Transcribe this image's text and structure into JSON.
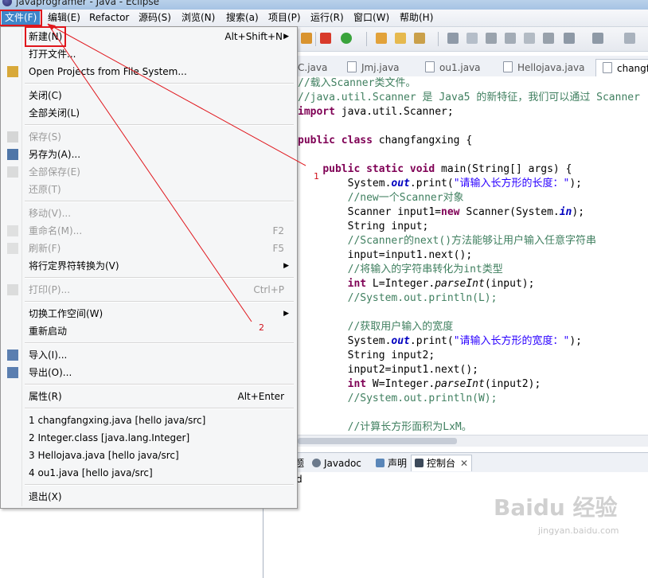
{
  "window": {
    "title": "javaprogramer - Java - Eclipse"
  },
  "menubar": {
    "items": [
      "文件(F)",
      "编辑(E)",
      "Refactor",
      "源码(S)",
      "浏览(N)",
      "搜索(a)",
      "项目(P)",
      "运行(R)",
      "窗口(W)",
      "帮助(H)"
    ]
  },
  "file_menu": {
    "items": [
      {
        "label": "新建(N)",
        "accel": "Alt+Shift+N",
        "submenu": true,
        "enabled": true
      },
      {
        "label": "打开文件...",
        "accel": "",
        "enabled": true
      },
      {
        "label": "Open Projects from File System...",
        "accel": "",
        "enabled": true
      },
      {
        "label": "关闭(C)",
        "accel": "",
        "enabled": true
      },
      {
        "label": "全部关闭(L)",
        "accel": "",
        "enabled": true
      },
      {
        "label": "保存(S)",
        "accel": "",
        "enabled": false
      },
      {
        "label": "另存为(A)...",
        "accel": "",
        "enabled": true
      },
      {
        "label": "全部保存(E)",
        "accel": "",
        "enabled": false
      },
      {
        "label": "还原(T)",
        "accel": "",
        "enabled": false
      },
      {
        "label": "移动(V)...",
        "accel": "",
        "enabled": false
      },
      {
        "label": "重命名(M)...",
        "accel": "F2",
        "enabled": false
      },
      {
        "label": "刷新(F)",
        "accel": "F5",
        "enabled": false
      },
      {
        "label": "将行定界符转换为(V)",
        "accel": "",
        "submenu": true,
        "enabled": true
      },
      {
        "label": "打印(P)...",
        "accel": "Ctrl+P",
        "enabled": false
      },
      {
        "label": "切换工作空间(W)",
        "accel": "",
        "submenu": true,
        "enabled": true
      },
      {
        "label": "重新启动",
        "accel": "",
        "enabled": true
      },
      {
        "label": "导入(I)...",
        "accel": "",
        "enabled": true
      },
      {
        "label": "导出(O)...",
        "accel": "",
        "enabled": true
      },
      {
        "label": "属性(R)",
        "accel": "Alt+Enter",
        "enabled": true
      },
      {
        "label": "1 changfangxing.java  [hello java/src]",
        "accel": "",
        "enabled": true
      },
      {
        "label": "2 Integer.class  [java.lang.Integer]",
        "accel": "",
        "enabled": true
      },
      {
        "label": "3 Hellojava.java  [hello java/src]",
        "accel": "",
        "enabled": true
      },
      {
        "label": "4 ou1.java  [hello java/src]",
        "accel": "",
        "enabled": true
      },
      {
        "label": "退出(X)",
        "accel": "",
        "enabled": true
      }
    ]
  },
  "editor_tabs": [
    "C.java",
    "Jmj.java",
    "ou1.java",
    "Hellojava.java",
    "changf"
  ],
  "code_lines": [
    "//载入Scanner类文件。",
    "//java.util.Scanner 是 Java5 的新特征，我们可以通过 Scanner",
    "import java.util.Scanner;",
    "",
    "public class changfangxing {",
    "",
    "    public static void main(String[] args) {",
    "        System.out.print(\"请输入长方形的长度：\");",
    "        //new一个Scanner对象",
    "        Scanner input1=new Scanner(System.in);",
    "        String input;",
    "        //Scanner的next()方法能够让用户输入任意字符串",
    "        input=input1.next();",
    "        //将输入的字符串转化为int类型",
    "        int L=Integer.parseInt(input);",
    "        //System.out.println(L);",
    "",
    "        //获取用户输入的宽度",
    "        System.out.print(\"请输入长方形的宽度：\");",
    "        String input2;",
    "        input2=input1.next();",
    "        int W=Integer.parseInt(input2);",
    "        //System.out.println(W);",
    "",
    "        //计算长方形面积为LxM。"
  ],
  "bottom_tabs": [
    "题",
    "Javadoc",
    "声明",
    "控制台"
  ],
  "console_text": "d",
  "annotations": {
    "step1": "1",
    "step2": "2"
  },
  "watermark": {
    "brand": "Baidu 经验",
    "url": "jingyan.baidu.com"
  },
  "colors": {
    "comment": "#3f7f5f",
    "keyword": "#7f0055",
    "string": "#2a00ff",
    "menu_active": "#3f86c9",
    "annotation_red": "#e0161c"
  }
}
